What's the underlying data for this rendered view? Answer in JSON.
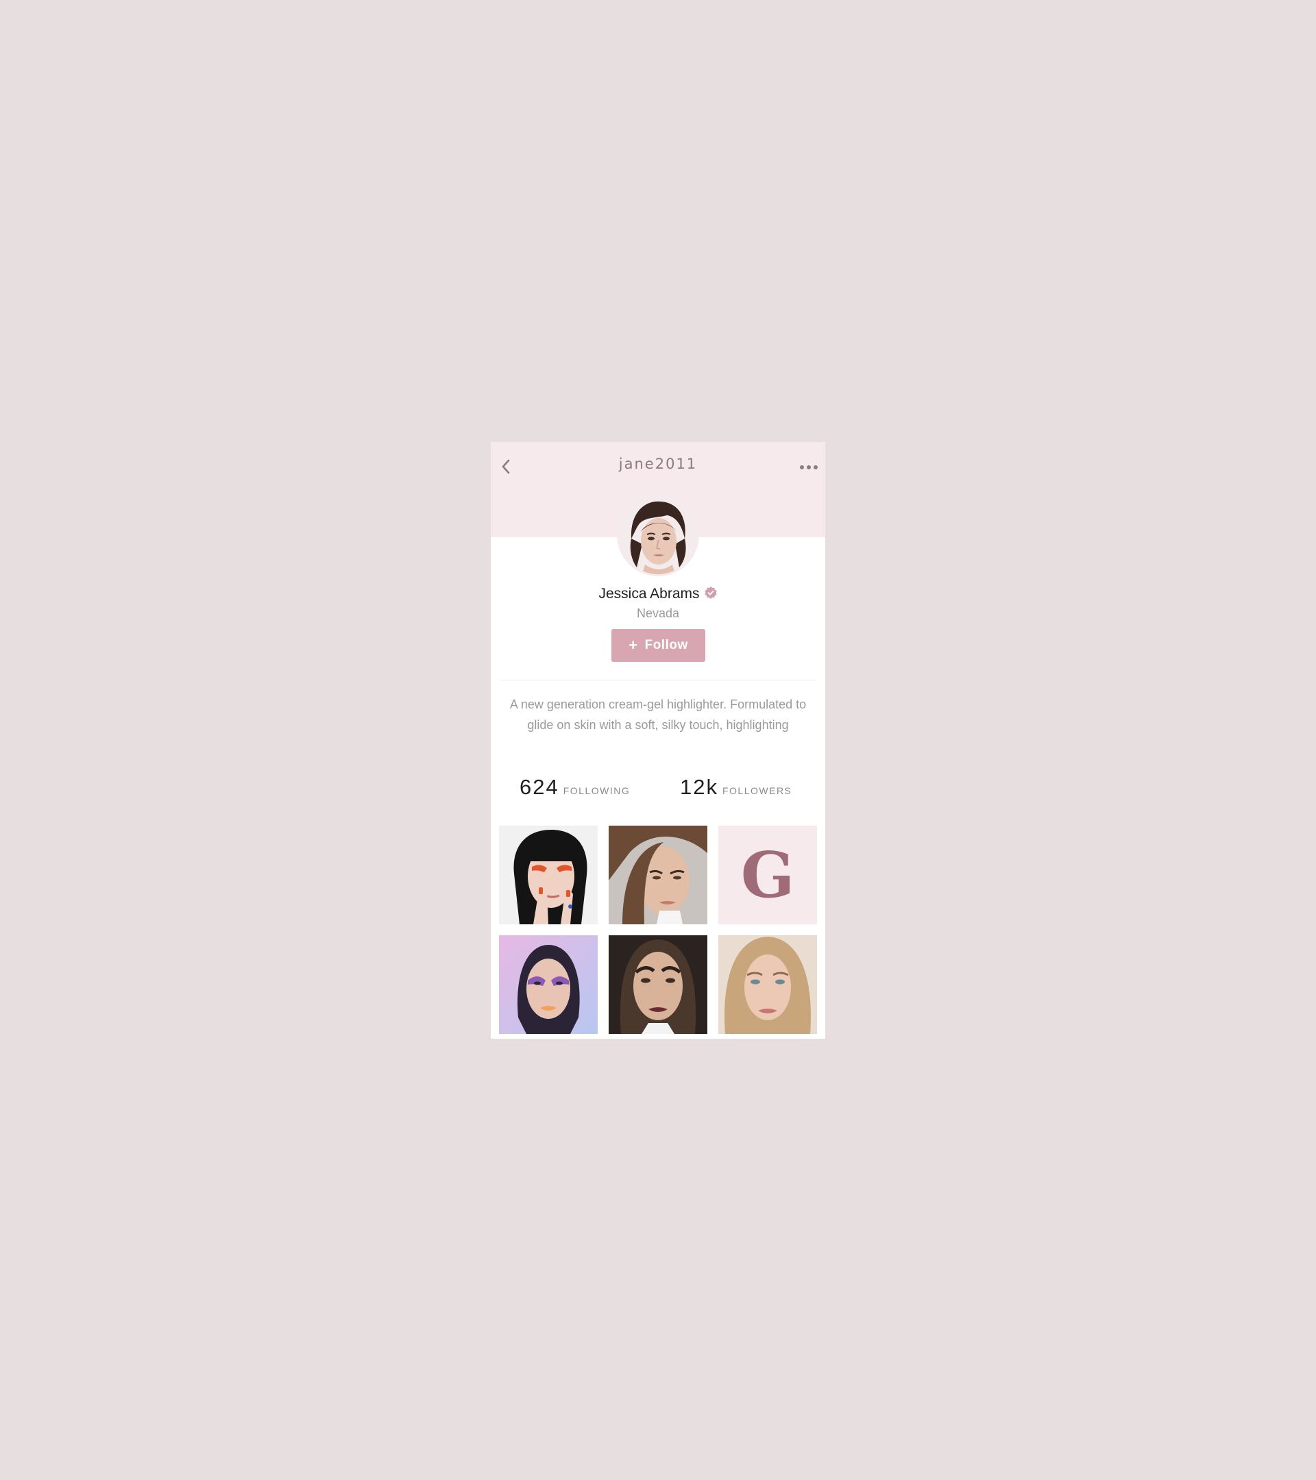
{
  "header": {
    "username": "jane2011",
    "back_icon": "chevron-left-icon",
    "more_icon": "more-horizontal-icon"
  },
  "profile": {
    "name": "Jessica Abrams",
    "verified_icon": "verified-badge-icon",
    "location": "Nevada",
    "follow_label": "Follow",
    "bio": "A new generation cream-gel highlighter. Formulated to glide on skin with a soft, silky touch, highlighting"
  },
  "stats": {
    "following_count": "624",
    "following_label": "FOLLOWING",
    "followers_count": "12k",
    "followers_label": "FOLLOWERS"
  },
  "gallery": {
    "logo_letter": "G"
  },
  "colors": {
    "page_background": "#e7dee0",
    "header_background": "#f6eaec",
    "accent": "#d8a6b0",
    "logo_letter": "#9e6b76"
  }
}
